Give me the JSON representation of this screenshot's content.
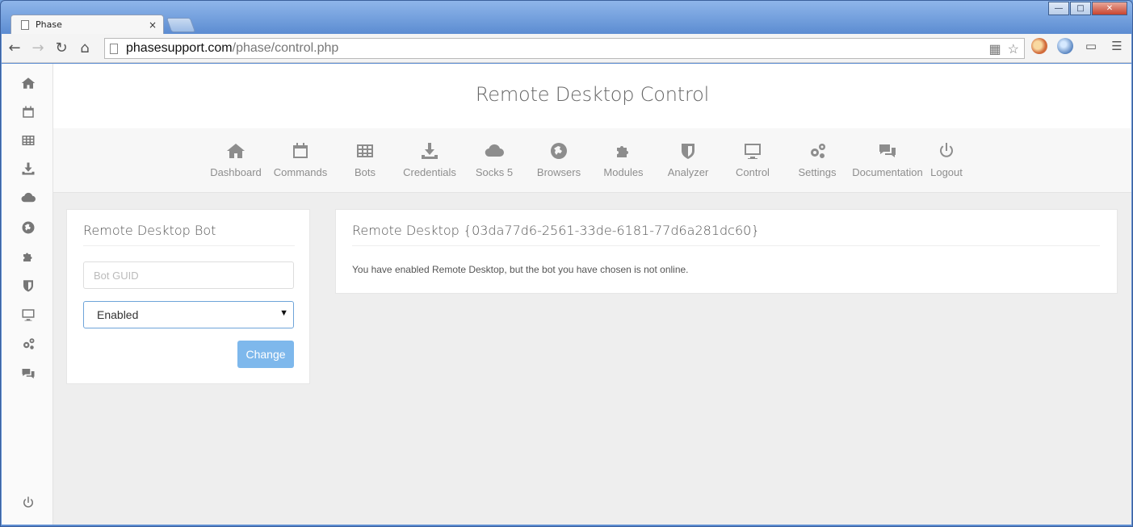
{
  "browser": {
    "tab_title": "Phase",
    "tab_close": "×",
    "url_host": "phasesupport.com",
    "url_path": "/phase/control.php",
    "window_controls": [
      "‗",
      "❐",
      "✕"
    ]
  },
  "header": {
    "title": "Remote Desktop Control"
  },
  "nav": {
    "items": [
      {
        "label": "Dashboard",
        "icon": "home-icon"
      },
      {
        "label": "Commands",
        "icon": "calendar-icon"
      },
      {
        "label": "Bots",
        "icon": "table-icon"
      },
      {
        "label": "Credentials",
        "icon": "download-icon"
      },
      {
        "label": "Socks 5",
        "icon": "cloud-icon"
      },
      {
        "label": "Browsers",
        "icon": "globe-icon"
      },
      {
        "label": "Modules",
        "icon": "puzzle-icon"
      },
      {
        "label": "Analyzer",
        "icon": "shield-icon"
      },
      {
        "label": "Control",
        "icon": "monitor-icon"
      },
      {
        "label": "Settings",
        "icon": "gears-icon"
      },
      {
        "label": "Documentation",
        "icon": "comments-icon"
      },
      {
        "label": "Logout",
        "icon": "power-icon"
      }
    ]
  },
  "sidebar": {
    "icons": [
      "home-icon",
      "calendar-icon",
      "table-icon",
      "download-icon",
      "cloud-icon",
      "globe-icon",
      "puzzle-icon",
      "shield-icon",
      "monitor-icon",
      "gears-icon",
      "comments-icon",
      "power-icon"
    ]
  },
  "bot_panel": {
    "title": "Remote Desktop Bot",
    "guid_placeholder": "Bot GUID",
    "guid_value": "",
    "select_value": "Enabled",
    "button_label": "Change"
  },
  "rd_panel": {
    "title": "Remote Desktop {03da77d6-2561-33de-6181-77d6a281dc60}",
    "message": "You have enabled Remote Desktop, but the bot you have chosen is not online."
  },
  "colors": {
    "button": "#7eb8ec",
    "select_border": "#6ea4d9",
    "page_bg": "#eeeeee"
  }
}
